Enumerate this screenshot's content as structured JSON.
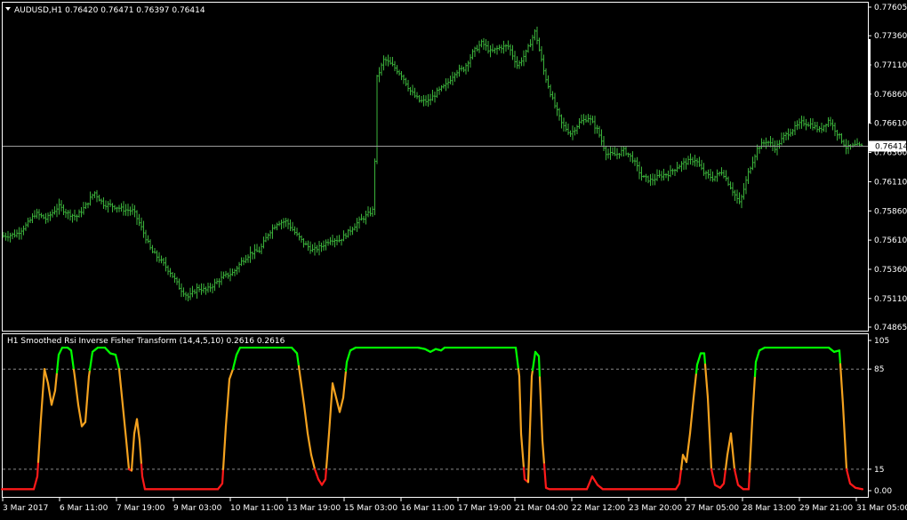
{
  "colors": {
    "background": "#000000",
    "frame": "#ffffff",
    "bars": "#3bb33b",
    "bid_line": "#9a9a9a",
    "level_line": "#8a8a8a",
    "osc_high": "#00ff00",
    "osc_mid": "#f4a21f",
    "osc_low": "#ff1a1a",
    "scroll_marker": "#ffffff"
  },
  "main": {
    "header": {
      "dropdown_icon": "triangle-down-icon",
      "title": "AUDUSD,H1  0.76420 0.76471 0.76397 0.76414"
    },
    "current_price": "0.76414",
    "price_range": [
      0.74865,
      0.77605
    ],
    "price_scale": [
      "0.77605",
      "0.77360",
      "0.77110",
      "0.76860",
      "0.76610",
      "0.76360",
      "0.76110",
      "0.75860",
      "0.75610",
      "0.75360",
      "0.75110",
      "0.74865"
    ]
  },
  "indicator": {
    "title": "H1 Smoothed Rsi Inverse Fisher Transform (14,4,5,10) 0.2616 0.2616",
    "range": [
      0,
      105
    ],
    "scale": [
      "105",
      "85",
      "15",
      "0.00"
    ],
    "levels": [
      85,
      15
    ]
  },
  "time_axis": {
    "labels": [
      "3 Mar 2017",
      "6 Mar 11:00",
      "7 Mar 19:00",
      "9 Mar 03:00",
      "10 Mar 11:00",
      "13 Mar 19:00",
      "15 Mar 03:00",
      "16 Mar 11:00",
      "17 Mar 19:00",
      "21 Mar 04:00",
      "22 Mar 12:00",
      "23 Mar 20:00",
      "27 Mar 05:00",
      "28 Mar 13:00",
      "29 Mar 21:00",
      "31 Mar 05:00"
    ]
  },
  "chart_data": [
    {
      "type": "line",
      "title": "AUDUSD,H1",
      "series": [
        {
          "name": "AUDUSD",
          "values": [
            [
              0,
              0.7564
            ],
            [
              18,
              0.7566
            ],
            [
              30,
              0.7574
            ],
            [
              40,
              0.7584
            ],
            [
              52,
              0.7579
            ],
            [
              66,
              0.759
            ],
            [
              76,
              0.7584
            ],
            [
              86,
              0.7581
            ],
            [
              96,
              0.759
            ],
            [
              106,
              0.7602
            ],
            [
              116,
              0.7592
            ],
            [
              128,
              0.759
            ],
            [
              140,
              0.7587
            ],
            [
              150,
              0.7586
            ],
            [
              160,
              0.757
            ],
            [
              170,
              0.7552
            ],
            [
              180,
              0.7544
            ],
            [
              192,
              0.7533
            ],
            [
              202,
              0.752
            ],
            [
              212,
              0.7512
            ],
            [
              222,
              0.752
            ],
            [
              232,
              0.7518
            ],
            [
              242,
              0.7524
            ],
            [
              252,
              0.753
            ],
            [
              262,
              0.7533
            ],
            [
              272,
              0.7543
            ],
            [
              282,
              0.755
            ],
            [
              292,
              0.7552
            ],
            [
              302,
              0.7567
            ],
            [
              312,
              0.7576
            ],
            [
              322,
              0.7577
            ],
            [
              332,
              0.7567
            ],
            [
              342,
              0.7558
            ],
            [
              352,
              0.7552
            ],
            [
              362,
              0.7556
            ],
            [
              372,
              0.7562
            ],
            [
              382,
              0.7561
            ],
            [
              392,
              0.7568
            ],
            [
              402,
              0.7576
            ],
            [
              412,
              0.7582
            ],
            [
              420,
              0.7587
            ],
            [
              424,
              0.77
            ],
            [
              432,
              0.7716
            ],
            [
              442,
              0.771
            ],
            [
              452,
              0.7702
            ],
            [
              462,
              0.7688
            ],
            [
              472,
              0.768
            ],
            [
              482,
              0.768
            ],
            [
              492,
              0.7688
            ],
            [
              502,
              0.7694
            ],
            [
              512,
              0.7705
            ],
            [
              522,
              0.7708
            ],
            [
              532,
              0.7722
            ],
            [
              542,
              0.773
            ],
            [
              552,
              0.7722
            ],
            [
              562,
              0.7726
            ],
            [
              572,
              0.7727
            ],
            [
              582,
              0.771
            ],
            [
              592,
              0.7722
            ],
            [
              602,
              0.774
            ],
            [
              612,
              0.7704
            ],
            [
              622,
              0.768
            ],
            [
              632,
              0.766
            ],
            [
              642,
              0.7652
            ],
            [
              652,
              0.7662
            ],
            [
              662,
              0.7666
            ],
            [
              672,
              0.7655
            ],
            [
              682,
              0.7635
            ],
            [
              692,
              0.7634
            ],
            [
              702,
              0.7638
            ],
            [
              712,
              0.763
            ],
            [
              722,
              0.7615
            ],
            [
              732,
              0.7612
            ],
            [
              742,
              0.7616
            ],
            [
              752,
              0.7618
            ],
            [
              762,
              0.7624
            ],
            [
              772,
              0.7628
            ],
            [
              782,
              0.763
            ],
            [
              792,
              0.7618
            ],
            [
              802,
              0.7614
            ],
            [
              812,
              0.762
            ],
            [
              822,
              0.7606
            ],
            [
              832,
              0.7592
            ],
            [
              842,
              0.762
            ],
            [
              852,
              0.764
            ],
            [
              862,
              0.7646
            ],
            [
              872,
              0.764
            ],
            [
              882,
              0.765
            ],
            [
              892,
              0.7656
            ],
            [
              902,
              0.7662
            ],
            [
              912,
              0.766
            ],
            [
              922,
              0.7655
            ],
            [
              932,
              0.7664
            ],
            [
              942,
              0.7652
            ],
            [
              952,
              0.764
            ],
            [
              962,
              0.7642
            ],
            [
              970,
              0.7641
            ]
          ]
        }
      ]
    },
    {
      "type": "line",
      "title": "H1 Smoothed Rsi Inverse Fisher Transform (14,4,5,10)",
      "ylim": [
        0,
        105
      ],
      "levels": [
        85,
        15
      ],
      "series": [
        {
          "name": "IFT",
          "values": [
            [
              2,
              1
            ],
            [
              38,
              1
            ],
            [
              42,
              10
            ],
            [
              46,
              50
            ],
            [
              50,
              85
            ],
            [
              54,
              75
            ],
            [
              58,
              60
            ],
            [
              62,
              70
            ],
            [
              66,
              95
            ],
            [
              70,
              100
            ],
            [
              76,
              100
            ],
            [
              80,
              98
            ],
            [
              84,
              80
            ],
            [
              88,
              60
            ],
            [
              92,
              45
            ],
            [
              96,
              48
            ],
            [
              100,
              80
            ],
            [
              104,
              97
            ],
            [
              110,
              100
            ],
            [
              118,
              100
            ],
            [
              124,
              96
            ],
            [
              130,
              95
            ],
            [
              134,
              85
            ],
            [
              138,
              60
            ],
            [
              142,
              35
            ],
            [
              145,
              15
            ],
            [
              148,
              14
            ],
            [
              151,
              40
            ],
            [
              154,
              50
            ],
            [
              157,
              35
            ],
            [
              160,
              10
            ],
            [
              163,
              1
            ],
            [
              245,
              1
            ],
            [
              250,
              5
            ],
            [
              254,
              45
            ],
            [
              258,
              78
            ],
            [
              262,
              85
            ],
            [
              266,
              95
            ],
            [
              270,
              100
            ],
            [
              276,
              100
            ],
            [
              280,
              100
            ],
            [
              320,
              100
            ],
            [
              328,
              100
            ],
            [
              334,
              96
            ],
            [
              338,
              78
            ],
            [
              342,
              60
            ],
            [
              346,
              40
            ],
            [
              350,
              25
            ],
            [
              354,
              15
            ],
            [
              358,
              8
            ],
            [
              362,
              4
            ],
            [
              366,
              8
            ],
            [
              370,
              40
            ],
            [
              374,
              75
            ],
            [
              378,
              65
            ],
            [
              382,
              55
            ],
            [
              386,
              65
            ],
            [
              390,
              90
            ],
            [
              394,
              98
            ],
            [
              400,
              100
            ],
            [
              470,
              100
            ],
            [
              478,
              99
            ],
            [
              484,
              97
            ],
            [
              490,
              99
            ],
            [
              496,
              98
            ],
            [
              500,
              100
            ],
            [
              580,
              100
            ],
            [
              584,
              80
            ],
            [
              586,
              40
            ],
            [
              590,
              8
            ],
            [
              594,
              6
            ],
            [
              598,
              80
            ],
            [
              602,
              97
            ],
            [
              606,
              94
            ],
            [
              610,
              35
            ],
            [
              614,
              2
            ],
            [
              618,
              1
            ],
            [
              660,
              1
            ],
            [
              666,
              10
            ],
            [
              672,
              4
            ],
            [
              678,
              1
            ],
            [
              760,
              1
            ],
            [
              764,
              5
            ],
            [
              768,
              25
            ],
            [
              772,
              20
            ],
            [
              776,
              40
            ],
            [
              780,
              65
            ],
            [
              784,
              88
            ],
            [
              788,
              96
            ],
            [
              792,
              96
            ],
            [
              796,
              65
            ],
            [
              800,
              15
            ],
            [
              804,
              4
            ],
            [
              810,
              2
            ],
            [
              814,
              5
            ],
            [
              818,
              25
            ],
            [
              822,
              40
            ],
            [
              826,
              15
            ],
            [
              830,
              4
            ],
            [
              836,
              1
            ],
            [
              842,
              1
            ],
            [
              846,
              50
            ],
            [
              850,
              90
            ],
            [
              854,
              98
            ],
            [
              860,
              100
            ],
            [
              926,
              100
            ],
            [
              932,
              100
            ],
            [
              938,
              97
            ],
            [
              944,
              98
            ],
            [
              948,
              60
            ],
            [
              952,
              15
            ],
            [
              956,
              5
            ],
            [
              962,
              2
            ],
            [
              970,
              1
            ]
          ]
        }
      ]
    }
  ]
}
